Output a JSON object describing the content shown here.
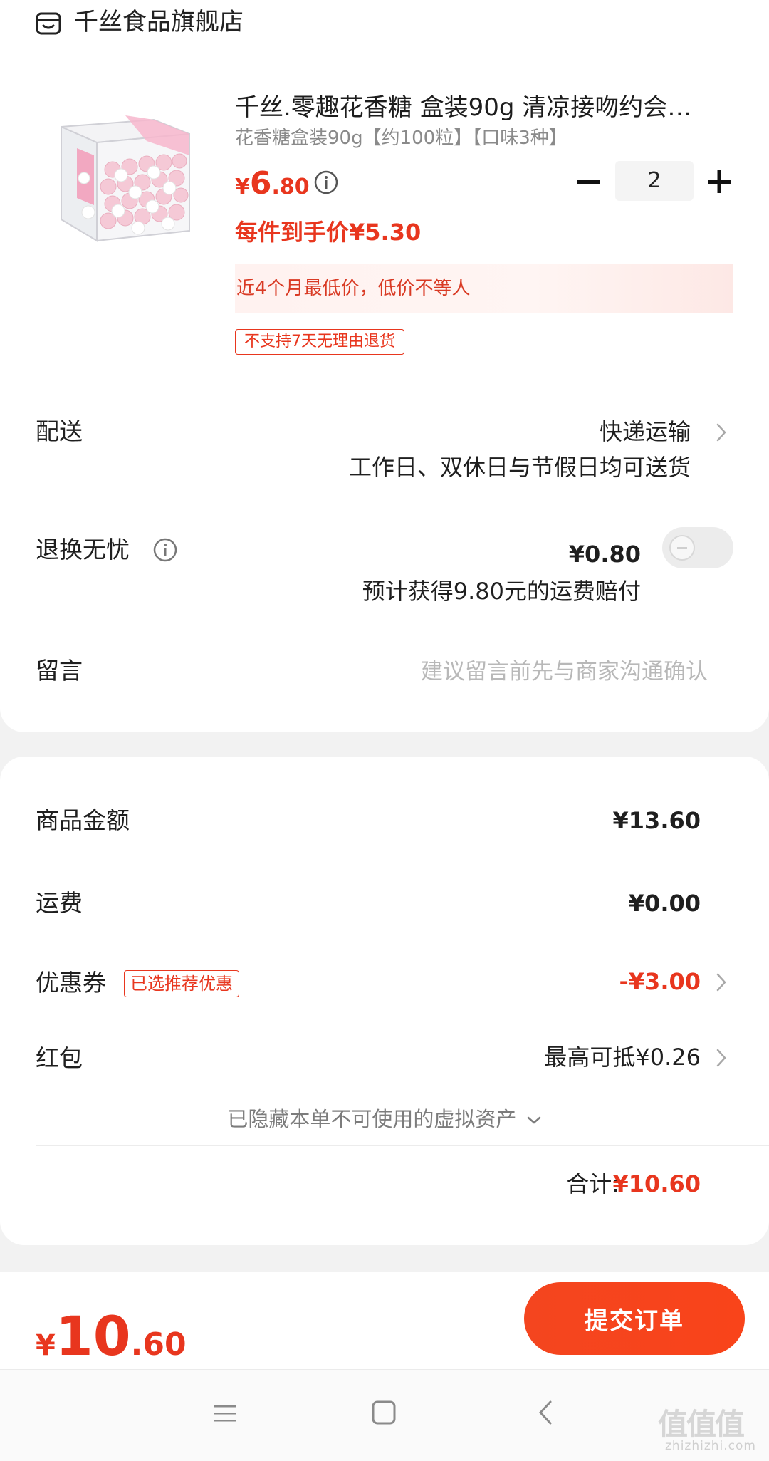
{
  "store": {
    "name": "千丝食品旗舰店",
    "icon": "store-icon"
  },
  "product": {
    "title": "千丝.零趣花香糖 盒装90g 清凉接吻约会…",
    "spec": "花香糖盒装90g【约100粒】【口味3种】",
    "price_currency": "¥",
    "price_int": "6",
    "price_dec": ".80",
    "quantity": "2",
    "final_price": "每件到手价¥5.30",
    "lowest_price_note": "近4个月最低价，低价不等人",
    "return_policy_tag": "不支持7天无理由退货"
  },
  "delivery": {
    "label": "配送",
    "method": "快递运输",
    "note": "工作日、双休日与节假日均可送货"
  },
  "return_insurance": {
    "label": "退换无忧",
    "price": "¥0.80",
    "enabled": false,
    "note": "预计获得9.80元的运费赔付"
  },
  "message": {
    "label": "留言",
    "placeholder": "建议留言前先与商家沟通确认"
  },
  "summary": {
    "goods_amount_label": "商品金额",
    "goods_amount": "¥13.60",
    "shipping_label": "运费",
    "shipping": "¥0.00",
    "coupon_label": "优惠券",
    "coupon_tag": "已选推荐优惠",
    "coupon_value": "-¥3.00",
    "redpacket_label": "红包",
    "redpacket_value": "最高可抵¥0.26",
    "hidden_assets": "已隐藏本单不可使用的虚拟资产",
    "total_label": "合计:",
    "total_value": "¥10.60"
  },
  "bottom_bar": {
    "currency": "¥",
    "price_int": "10",
    "price_dec": ".60",
    "submit_label": "提交订单"
  },
  "watermark": {
    "text": "值值值",
    "url": "zhizhizhi.com"
  },
  "colors": {
    "accent": "#e8361e",
    "button": "#f4451f"
  }
}
